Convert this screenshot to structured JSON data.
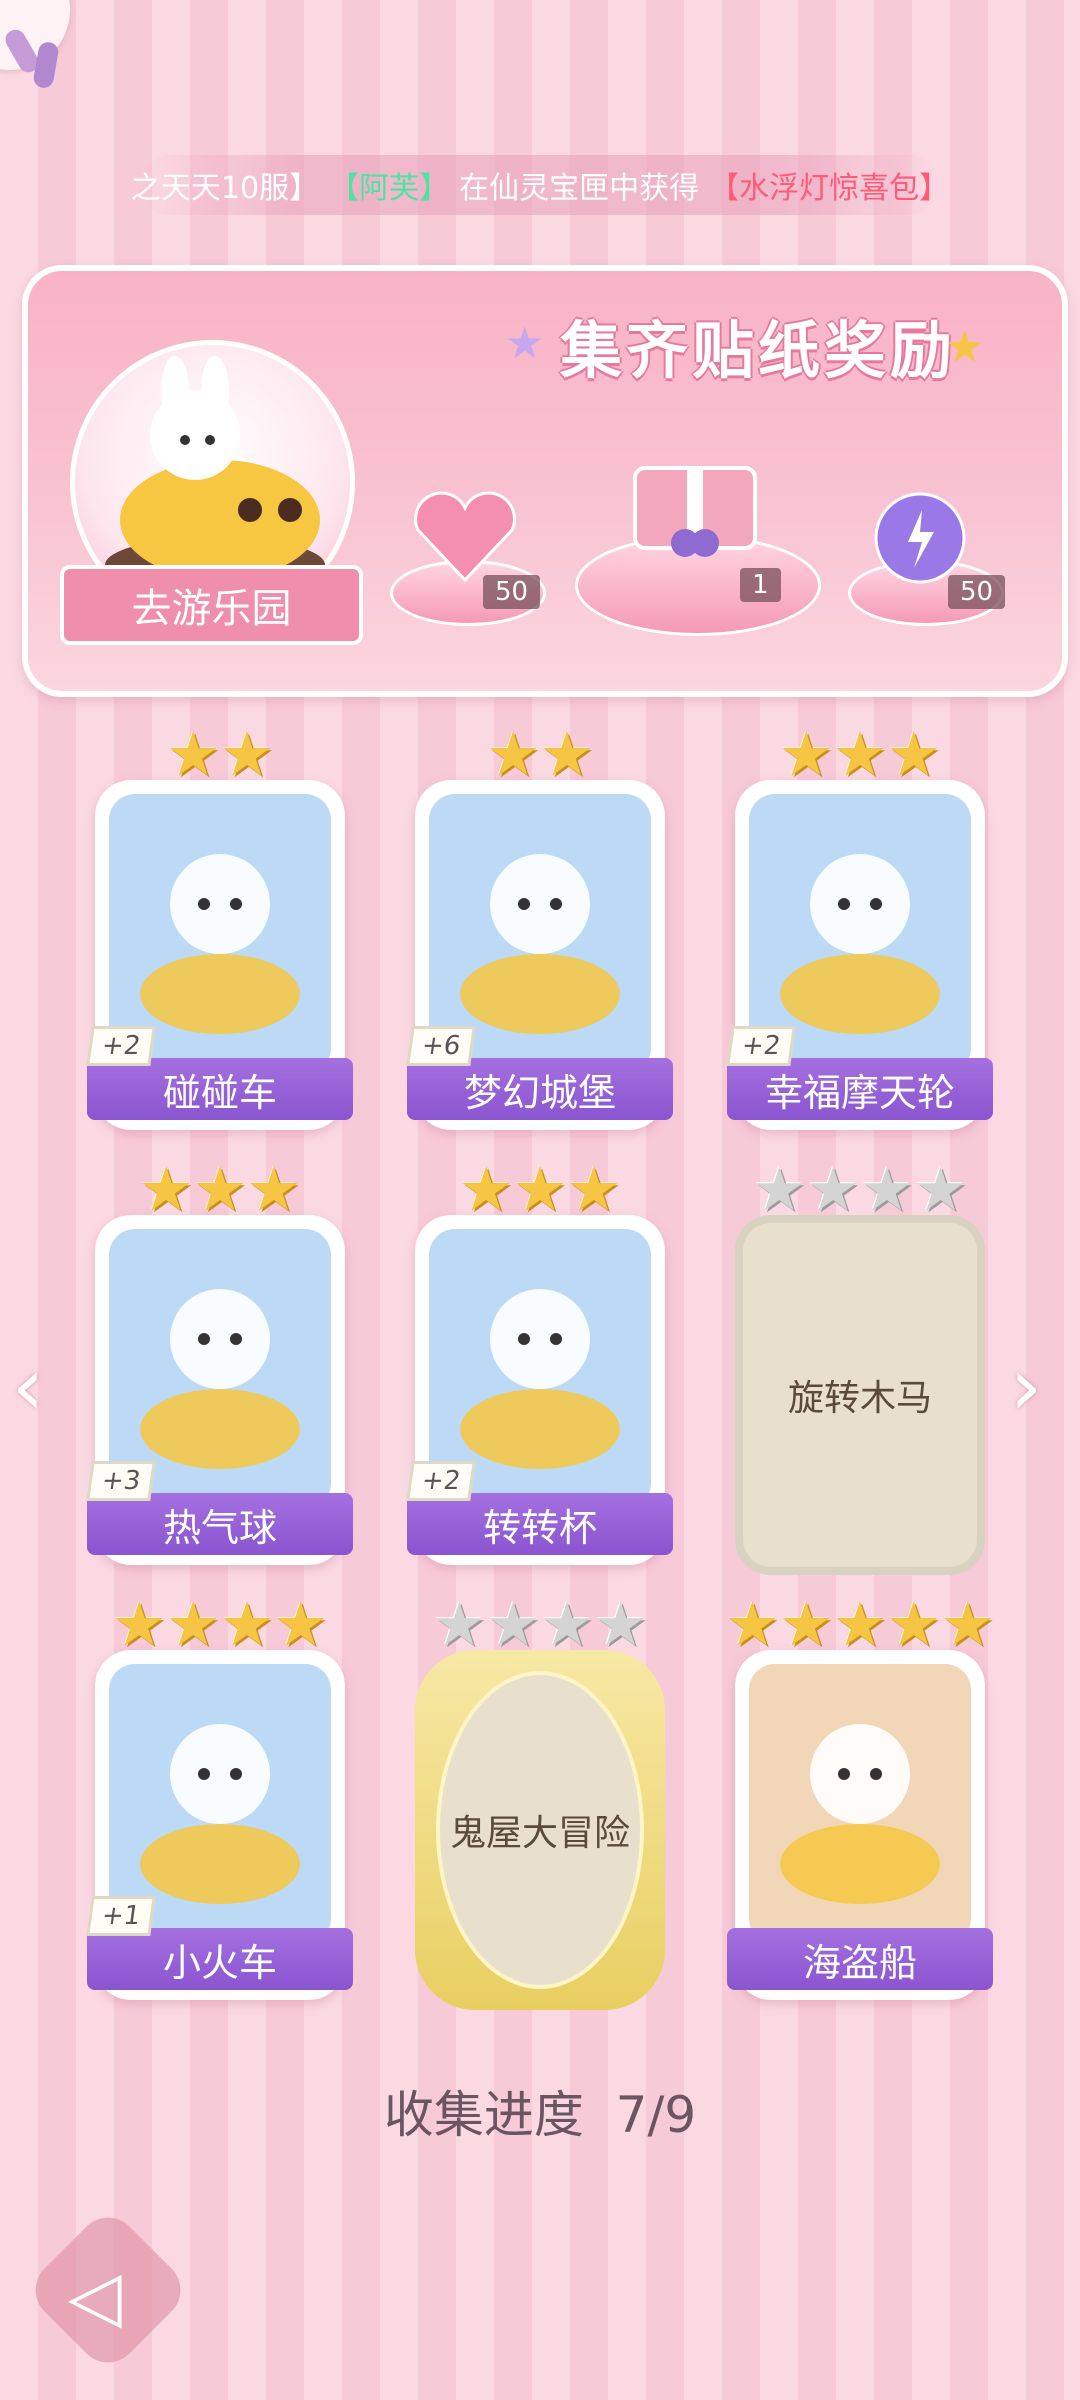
{
  "ticker": {
    "prefix": "之天天10服】",
    "player": "【阿芙】",
    "middle": "在仙灵宝匣中获得",
    "item": "【水浮灯惊喜包】"
  },
  "banner": {
    "title": "集齐贴纸奖励",
    "go_button": "去游乐园",
    "rewards": [
      {
        "icon": "heart-gem-icon",
        "count": "50"
      },
      {
        "icon": "gift-box-icon",
        "count": "1"
      },
      {
        "icon": "energy-orb-icon",
        "count": "50"
      }
    ]
  },
  "cards": [
    {
      "name": "碰碰车",
      "stars": 2,
      "max_stars": 2,
      "bonus": "+2",
      "unlocked": true,
      "bg": "#bcd9f5"
    },
    {
      "name": "梦幻城堡",
      "stars": 2,
      "max_stars": 2,
      "bonus": "+6",
      "unlocked": true,
      "bg": "#bcd9f5"
    },
    {
      "name": "幸福摩天轮",
      "stars": 3,
      "max_stars": 3,
      "bonus": "+2",
      "unlocked": true,
      "bg": "#bcd9f5"
    },
    {
      "name": "热气球",
      "stars": 3,
      "max_stars": 3,
      "bonus": "+3",
      "unlocked": true,
      "bg": "#bcd9f5"
    },
    {
      "name": "转转杯",
      "stars": 3,
      "max_stars": 3,
      "bonus": "+2",
      "unlocked": true,
      "bg": "#bcd9f5"
    },
    {
      "name": "旋转木马",
      "stars": 0,
      "max_stars": 4,
      "bonus": "",
      "unlocked": false
    },
    {
      "name": "小火车",
      "stars": 4,
      "max_stars": 4,
      "bonus": "+1",
      "unlocked": true,
      "bg": "#bcd9f5"
    },
    {
      "name": "鬼屋大冒险",
      "stars": 0,
      "max_stars": 4,
      "bonus": "",
      "unlocked": false
    },
    {
      "name": "海盗船",
      "stars": 5,
      "max_stars": 5,
      "bonus": "",
      "unlocked": true,
      "bg": "#f2d6b8"
    }
  ],
  "progress": {
    "label": "收集进度",
    "value": "7/9"
  },
  "colors": {
    "label_purple": "#9a63d8",
    "star_gold": "#f6c543",
    "star_gray": "#d4d4d4",
    "banner_pink": "#f9b3c6"
  }
}
